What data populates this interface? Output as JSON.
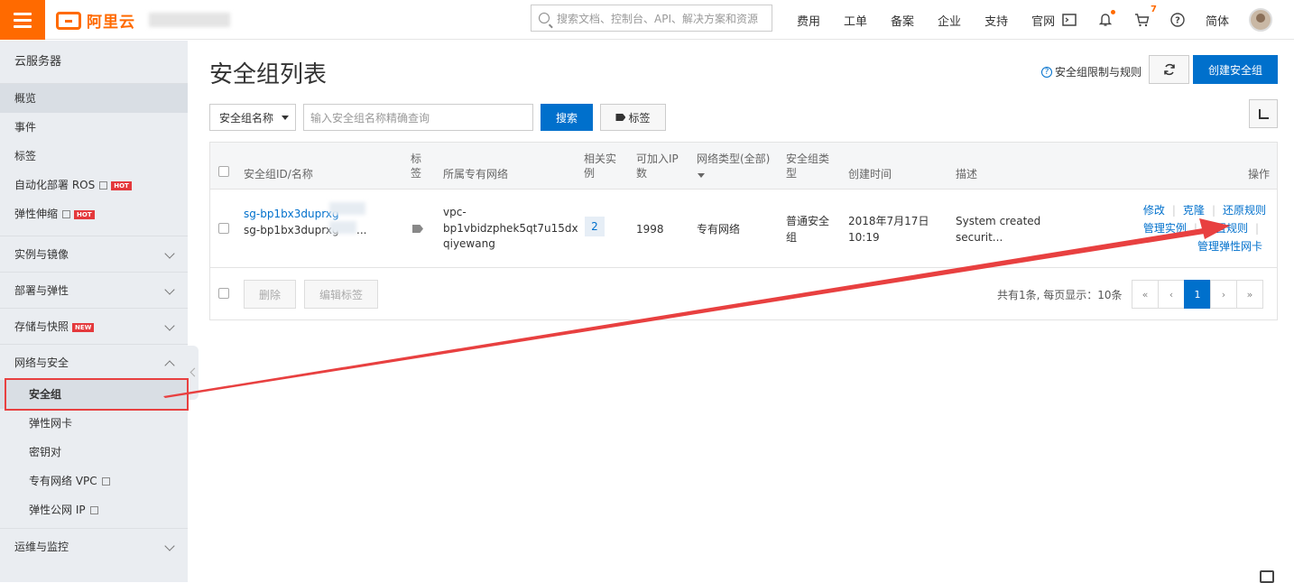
{
  "brand": {
    "name": "阿里云",
    "accent": "#ff6a00",
    "primary": "#0070cc"
  },
  "header": {
    "search_placeholder": "搜索文档、控制台、API、解决方案和资源",
    "links": [
      "费用",
      "工单",
      "备案",
      "企业",
      "支持",
      "官网"
    ],
    "cart_count": "7",
    "lang": "简体"
  },
  "sidebar": {
    "title": "云服务器",
    "top_items": [
      {
        "label": "概览"
      },
      {
        "label": "事件"
      },
      {
        "label": "标签"
      },
      {
        "label": "自动化部署 ROS",
        "badge": "HOT"
      },
      {
        "label": "弹性伸缩",
        "badge": "HOT"
      }
    ],
    "groups": [
      {
        "label": "实例与镜像"
      },
      {
        "label": "部署与弹性"
      },
      {
        "label": "存储与快照",
        "badge": "NEW"
      },
      {
        "label": "网络与安全"
      }
    ],
    "network_items": [
      {
        "label": "安全组"
      },
      {
        "label": "弹性网卡"
      },
      {
        "label": "密钥对"
      },
      {
        "label": "专有网络 VPC"
      },
      {
        "label": "弹性公网 IP"
      }
    ],
    "ops_group": "运维与监控"
  },
  "page": {
    "title": "安全组列表",
    "help_link": "安全组限制与规则",
    "create_button": "创建安全组",
    "filter_field": "安全组名称",
    "filter_placeholder": "输入安全组名称精确查询",
    "search_button": "搜索",
    "tag_button": "标签"
  },
  "table": {
    "headers": {
      "id_name": "安全组ID/名称",
      "tag": "标签",
      "vpc": "所属专有网络",
      "related": "相关实例",
      "joinable_ip": "可加入IP数",
      "net_type": "网络类型(全部)",
      "sg_type": "安全组类型",
      "created": "创建时间",
      "desc": "描述",
      "ops": "操作"
    },
    "row": {
      "id": "sg-bp1bx3duprxg",
      "name": "sg-bp1bx3duprxg",
      "name_suffix": "...",
      "vpc_line1": "vpc-",
      "vpc_line2": "bp1vbidzphek5qt7u15dx",
      "vpc_line3": "qiyewang",
      "related": "2",
      "joinable_ip": "1998",
      "net_type": "专有网络",
      "sg_type_line1": "普通安全",
      "sg_type_line2": "组",
      "created_line1": "2018年7月17日",
      "created_line2": "10:19",
      "desc_line1": "System created",
      "desc_line2": "securit...",
      "ops": [
        "修改",
        "克隆",
        "还原规则",
        "管理实例",
        "配置规则",
        "管理弹性网卡"
      ]
    },
    "footer": {
      "delete_button": "删除",
      "edit_tags_button": "编辑标签",
      "summary": "共有1条, 每页显示：10条",
      "pages": [
        "«",
        "‹",
        "1",
        "›",
        "»"
      ],
      "current_page": "1"
    }
  },
  "annotation_color": "#e84040"
}
